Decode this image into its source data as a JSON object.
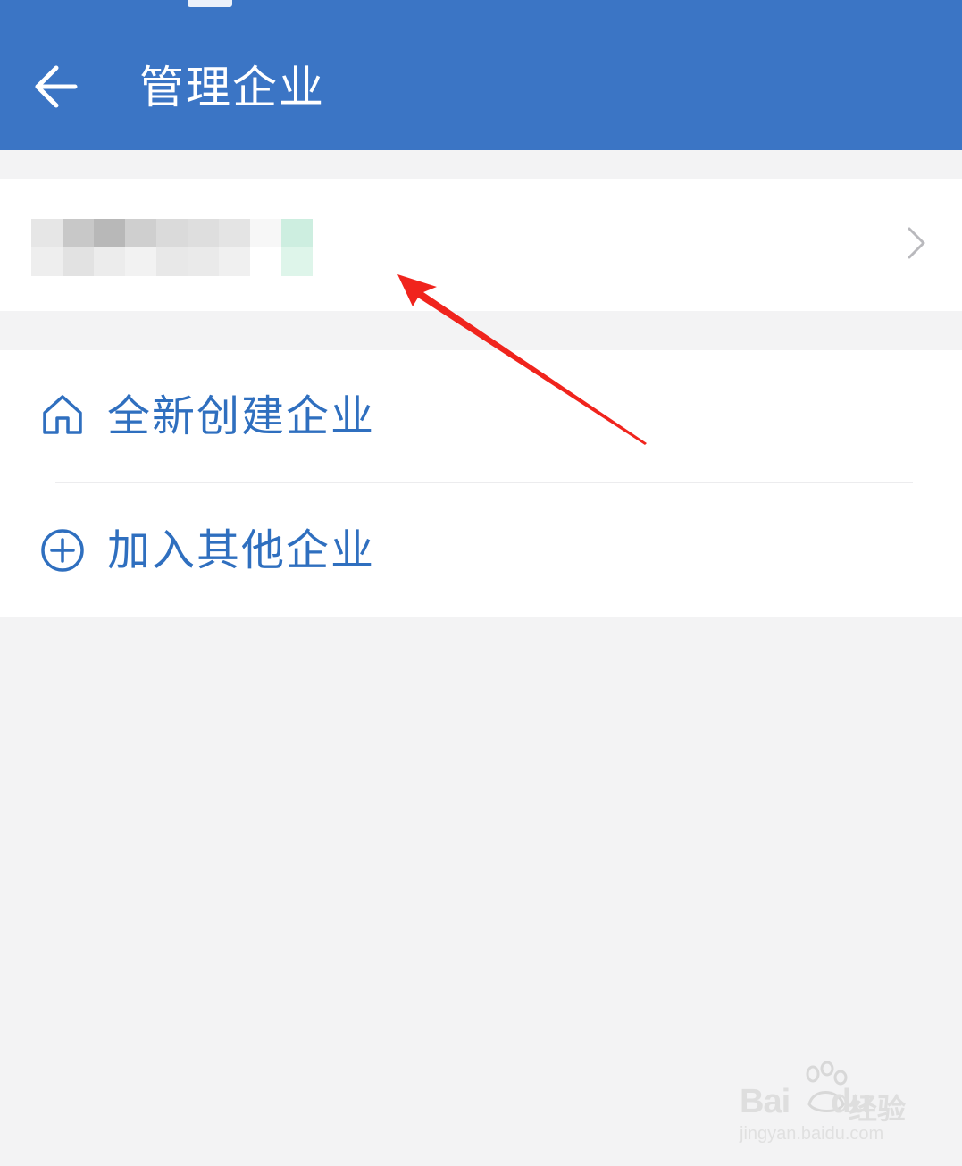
{
  "header": {
    "title": "管理企业",
    "back_icon": "arrow-left-icon",
    "background_color": "#3b75c5"
  },
  "company_item": {
    "name_redacted": true,
    "chevron_icon": "chevron-right-icon"
  },
  "actions": [
    {
      "label": "全新创建企业",
      "icon": "home-icon",
      "color": "#2f6fbf"
    },
    {
      "label": "加入其他企业",
      "icon": "plus-circle-icon",
      "color": "#2f6fbf"
    }
  ],
  "annotation": {
    "type": "arrow",
    "color": "#f0241d",
    "points_to": "company_item"
  },
  "watermark": {
    "brand_left": "Bai",
    "brand_right": "du",
    "product": "经验",
    "url": "jingyan.baidu.com"
  }
}
